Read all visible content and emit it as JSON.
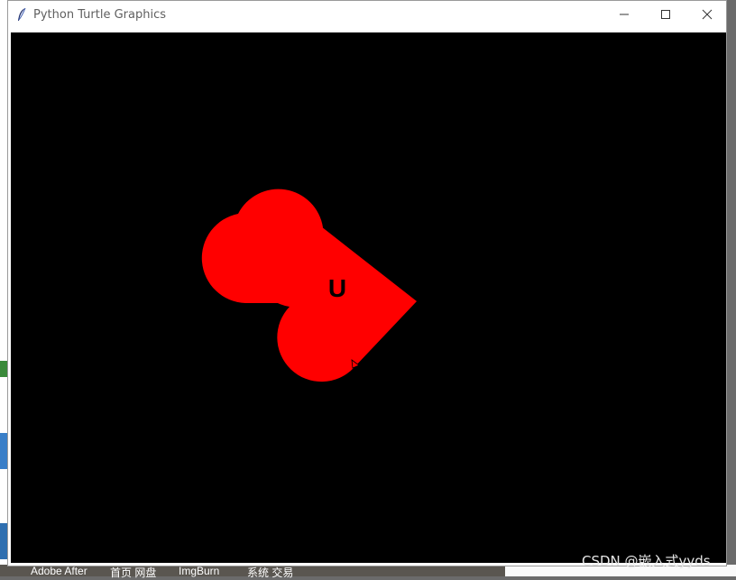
{
  "window": {
    "title": "Python Turtle Graphics",
    "controls": [
      "minimize",
      "maximize",
      "close"
    ]
  },
  "canvas": {
    "background": "#000000",
    "shape_color": "#ff0000",
    "label": "U",
    "label_color": "#000000"
  },
  "taskbar": {
    "items": [
      "Adobe After",
      "首页 网盘",
      "ImgBurn",
      "系统 交易"
    ]
  },
  "watermark": "CSDN @嵌入式yyds"
}
